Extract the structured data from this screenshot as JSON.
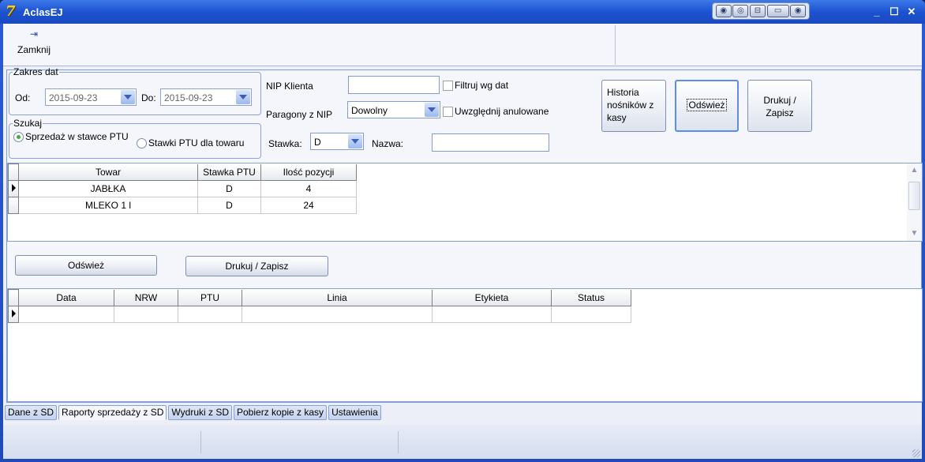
{
  "window": {
    "title": "AclasEJ",
    "app_icon_glyph": "7",
    "tools": [
      "◉",
      "◎",
      "⊟",
      "▭",
      "◉"
    ],
    "buttons": {
      "minimize": "_",
      "maximize": "☐",
      "close": "✕"
    }
  },
  "toolbar": {
    "close_label": "Zamknij",
    "close_icon": "exit-door-icon"
  },
  "filters": {
    "date_range": {
      "legend": "Zakres dat",
      "from_label": "Od:",
      "from_value": "2015-09-23",
      "to_label": "Do:",
      "to_value": "2015-09-23"
    },
    "search": {
      "legend": "Szukaj",
      "option1": "Sprzedaż w stawce PTU",
      "option2": "Stawki PTU dla towaru",
      "selected": "option1"
    },
    "nip_label": "NIP Klienta",
    "nip_value": "",
    "filter_by_date_label": "Filtruj wg dat",
    "receipts_nip_label": "Paragony z NIP",
    "receipts_nip_value": "Dowolny",
    "include_cancelled_label": "Uwzględnij anulowane",
    "rate_label": "Stawka:",
    "rate_value": "D",
    "name_label": "Nazwa:",
    "name_value": ""
  },
  "actions": {
    "history_label": "Historia nośników z kasy",
    "refresh_label": "Odśwież",
    "print_save_label": "Drukuj / Zapisz"
  },
  "grid1": {
    "columns": [
      "Towar",
      "Stawka PTU",
      "Ilość pozycji"
    ],
    "rows": [
      [
        "JABŁKA",
        "D",
        "4"
      ],
      [
        "MLEKO 1 l",
        "D",
        "24"
      ]
    ]
  },
  "middle": {
    "refresh_label": "Odśwież",
    "print_save_label": "Drukuj / Zapisz"
  },
  "grid2": {
    "columns": [
      "Data",
      "NRW",
      "PTU",
      "Linia",
      "Etykieta",
      "Status"
    ],
    "rows": [
      [
        "",
        "",
        "",
        "",
        "",
        ""
      ]
    ]
  },
  "tabs": [
    {
      "label": "Dane z SD",
      "active": false
    },
    {
      "label": "Raporty sprzedaży z SD",
      "active": true
    },
    {
      "label": "Wydruki z SD",
      "active": false
    },
    {
      "label": "Pobierz kopie z kasy",
      "active": false
    },
    {
      "label": "Ustawienia",
      "active": false
    }
  ]
}
